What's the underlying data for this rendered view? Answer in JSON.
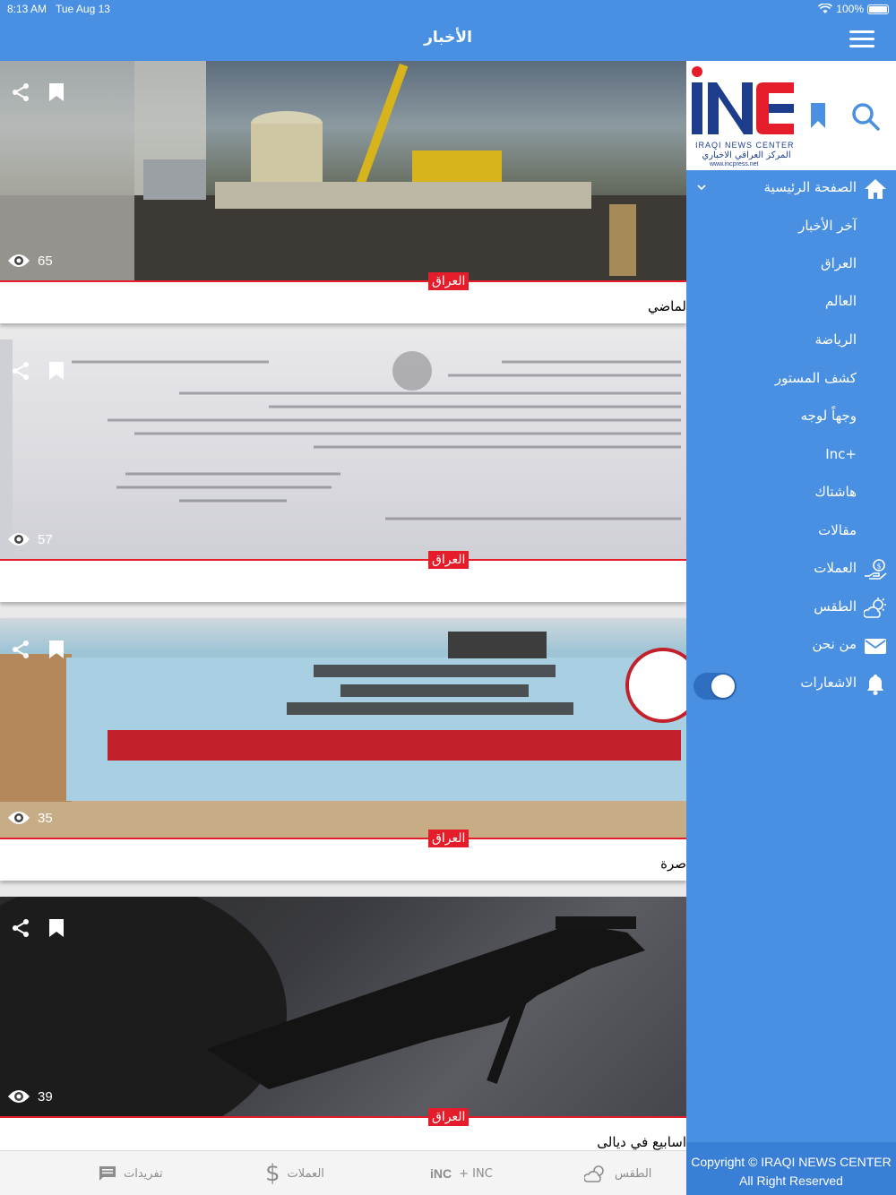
{
  "status_bar": {
    "time": "8:13 AM",
    "date": "Tue Aug 13",
    "battery": "100%"
  },
  "nav": {
    "title": "الأخبار"
  },
  "feed": [
    {
      "category": "العراق",
      "title": "لماضي",
      "views": "65"
    },
    {
      "category": "العراق",
      "title": "",
      "views": "57"
    },
    {
      "category": "العراق",
      "title": "صرة",
      "views": "35"
    },
    {
      "category": "العراق",
      "title": "اسابيع في ديالى",
      "views": "39"
    }
  ],
  "drawer": {
    "logo_en": "IRAQI NEWS CENTER",
    "logo_ar": "المركز العراقي الاخباري",
    "logo_url": "www.incpress.net",
    "menu": {
      "home": "الصفحة الرئيسية",
      "latest": "آخر الأخبار",
      "iraq": "العراق",
      "world": "العالم",
      "sports": "الرياضة",
      "kashf": "كشف المستور",
      "wajhan": "وجهاً لوجه",
      "inc_plus": "Inc+",
      "hashtag": "هاشتاك",
      "articles": "مقالات",
      "currencies": "العملات",
      "weather": "الطقس",
      "about": "من نحن",
      "notifications": "الاشعارات"
    },
    "notifications_on": true,
    "copyright_line1": "Copyright © IRAQI NEWS CENTER",
    "copyright_line2": "All Right Reserved"
  },
  "tabbar": {
    "tweets": "تفريدات",
    "currencies": "العملات",
    "inc": "+ INC",
    "weather": "الطقس"
  },
  "colors": {
    "primary": "#4a90e2",
    "accent_red": "#e51d2a"
  }
}
